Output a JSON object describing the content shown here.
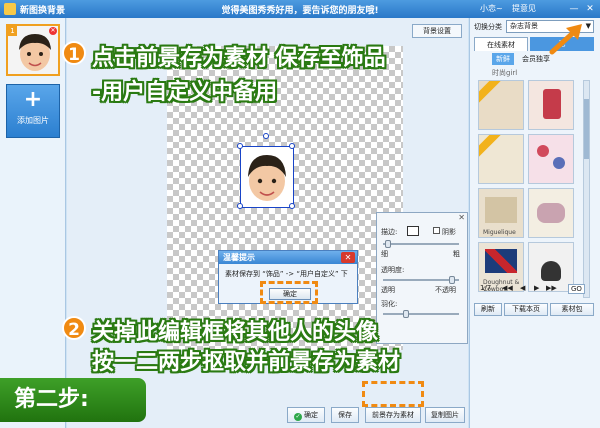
{
  "titlebar": {
    "title": "新图换背景",
    "banner": "觉得美图秀秀好用，要告诉您的朋友哦!",
    "user": "小恋~",
    "feedback": "提意见",
    "min": "—",
    "close": "✕"
  },
  "left": {
    "thumb_index": "1",
    "add_label": "添加图片"
  },
  "canvas": {
    "bg_setting": "背景设置",
    "ok": "确定",
    "save": "保存",
    "save_as_material": "前景存为素材",
    "copy_image": "复制图片"
  },
  "edit_panel": {
    "stroke": "描边:",
    "shadow": "阴影",
    "thin": "细",
    "thick": "粗",
    "transparency": "透明度:",
    "transparent": "透明",
    "opaque": "不透明",
    "feather": "羽化:"
  },
  "dialog": {
    "title": "温馨提示",
    "message": "素材保存到 “饰品” -> “用户自定义” 下",
    "ok": "确定",
    "close": "✕"
  },
  "right": {
    "switch_label": "切换分类",
    "category": "杂志背景",
    "tab_online": "在线素材",
    "tab_second": "已",
    "sub_new": "新鲜",
    "sub_member": "会员独享",
    "search_text": "时尚girl",
    "page": "1/7",
    "refresh": "刷新",
    "download_page": "下载本页",
    "material_pack": "素材包",
    "cells": [
      "",
      "",
      "",
      "",
      "Miguelique",
      "",
      "Doughnut & Cowboy",
      ""
    ]
  },
  "overlay": {
    "step1_num": "1",
    "step1_line1": "点击前景存为素材 保存至饰品",
    "step1_line2": "-用户自定义中备用",
    "step2_num": "2",
    "step2_line1": "关掉此编辑框将其他人的头像",
    "step2_line2": "按一二两步抠取并前景存为素材",
    "step_label": "第二步:"
  },
  "colors": {
    "accent_orange": "#f08a12",
    "title_blue": "#2a78c8",
    "step_green": "#2a8a18"
  }
}
